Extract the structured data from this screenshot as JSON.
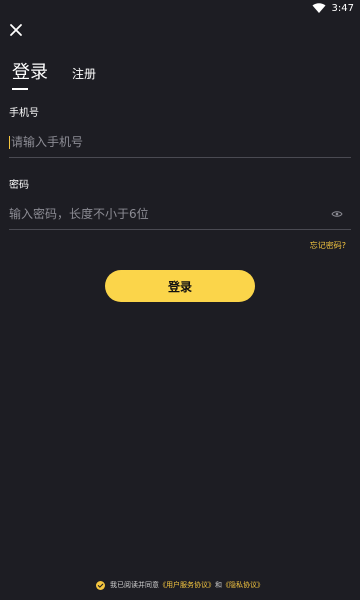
{
  "status_bar": {
    "time": "3:47"
  },
  "tabs": {
    "login": "登录",
    "register": "注册"
  },
  "phone_field": {
    "label": "手机号",
    "placeholder": "请输入手机号"
  },
  "password_field": {
    "label": "密码",
    "placeholder": "输入密码，长度不小于6位"
  },
  "forgot_password": "忘记密码?",
  "login_button": "登录",
  "agreement": {
    "prefix": "我已阅读并同意",
    "user_agreement": "《用户服务协议》",
    "conjunction": "和",
    "privacy_policy": "《隐私协议》"
  },
  "colors": {
    "background": "#1d1d23",
    "accent": "#fbd54a",
    "link": "#f5c640"
  },
  "icons": {
    "status": [
      "wifi-icon"
    ],
    "close": "close-icon",
    "password_visibility": "eye-icon",
    "agreement": "check-circle-icon"
  }
}
